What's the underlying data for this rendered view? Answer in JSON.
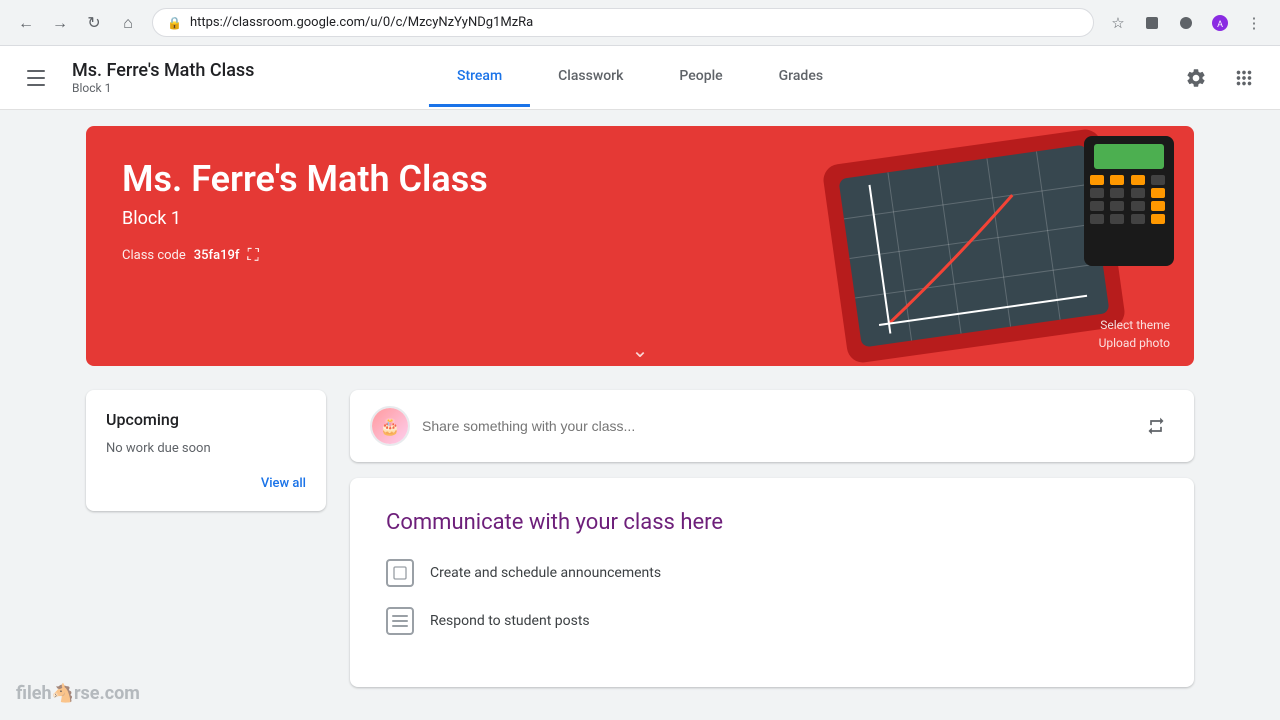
{
  "browser": {
    "url": "https://classroom.google.com/u/0/c/MzcyNzYyNDg1MzRa",
    "back_disabled": false
  },
  "header": {
    "class_name": "Ms. Ferre's Math Class",
    "class_subtitle": "Block 1",
    "hamburger_label": "Menu",
    "settings_label": "Settings",
    "apps_label": "Google apps"
  },
  "nav": {
    "tabs": [
      {
        "id": "stream",
        "label": "Stream",
        "active": true
      },
      {
        "id": "classwork",
        "label": "Classwork",
        "active": false
      },
      {
        "id": "people",
        "label": "People",
        "active": false
      },
      {
        "id": "grades",
        "label": "Grades",
        "active": false
      }
    ]
  },
  "hero": {
    "title": "Ms. Ferre's Math Class",
    "block": "Block 1",
    "class_code_label": "Class code",
    "class_code_value": "35fa19f",
    "select_theme_label": "Select theme",
    "upload_photo_label": "Upload photo"
  },
  "upcoming": {
    "title": "Upcoming",
    "no_work_text": "No work due soon",
    "view_all_label": "View all"
  },
  "share_box": {
    "placeholder": "Share something with your class..."
  },
  "communicate": {
    "title": "Communicate with your class here",
    "items": [
      {
        "id": "announcements",
        "text": "Create and schedule announcements",
        "icon_type": "square"
      },
      {
        "id": "posts",
        "text": "Respond to student posts",
        "icon_type": "lines"
      }
    ]
  },
  "watermark": {
    "text": "fileh",
    "horse": "🐴",
    "suffix": "rse.com"
  }
}
